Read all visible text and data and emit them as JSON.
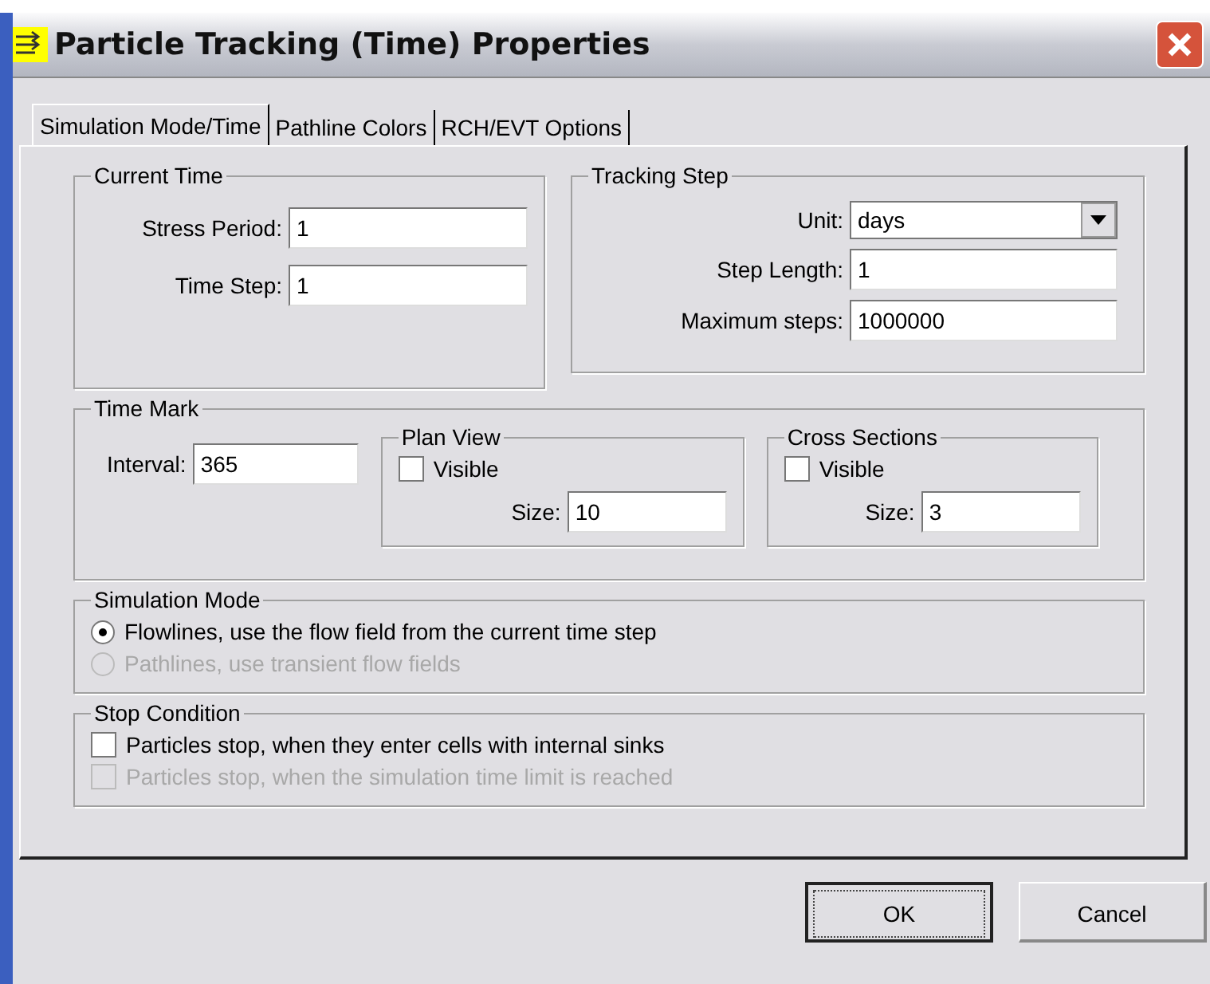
{
  "window": {
    "title": "Particle Tracking (Time) Properties"
  },
  "tabs": [
    {
      "label": "Simulation Mode/Time",
      "selected": true
    },
    {
      "label": "Pathline Colors",
      "selected": false
    },
    {
      "label": "RCH/EVT Options",
      "selected": false
    }
  ],
  "current_time": {
    "title": "Current Time",
    "fields": [
      {
        "label": "Stress Period:",
        "value": "1"
      },
      {
        "label": "Time Step:",
        "value": "1"
      }
    ]
  },
  "tracking_step": {
    "title": "Tracking Step",
    "unit": {
      "label": "Unit:",
      "value": "days"
    },
    "fields": [
      {
        "label": "Step Length:",
        "value": "1"
      },
      {
        "label": "Maximum steps:",
        "value": "1000000"
      }
    ]
  },
  "time_mark": {
    "title": "Time Mark",
    "interval": {
      "label": "Interval:",
      "value": "365"
    },
    "groups": [
      {
        "title": "Plan View",
        "visible": {
          "label": "Visible",
          "checked": false
        },
        "size": {
          "label": "Size:",
          "value": "10"
        }
      },
      {
        "title": "Cross Sections",
        "visible": {
          "label": "Visible",
          "checked": false
        },
        "size": {
          "label": "Size:",
          "value": "3"
        }
      }
    ]
  },
  "simulation_mode": {
    "title": "Simulation Mode",
    "options": [
      {
        "label": "Flowlines, use the flow field from the current time step",
        "selected": true,
        "disabled": false
      },
      {
        "label": "Pathlines, use transient flow fields",
        "selected": false,
        "disabled": true
      }
    ]
  },
  "stop_condition": {
    "title": "Stop Condition",
    "options": [
      {
        "label": "Particles stop, when they enter cells with internal sinks",
        "checked": false,
        "disabled": false
      },
      {
        "label": "Particles stop, when the simulation time limit is reached",
        "checked": false,
        "disabled": true
      }
    ]
  },
  "buttons": [
    {
      "label": "OK",
      "default": true
    },
    {
      "label": "Cancel",
      "default": false
    }
  ]
}
